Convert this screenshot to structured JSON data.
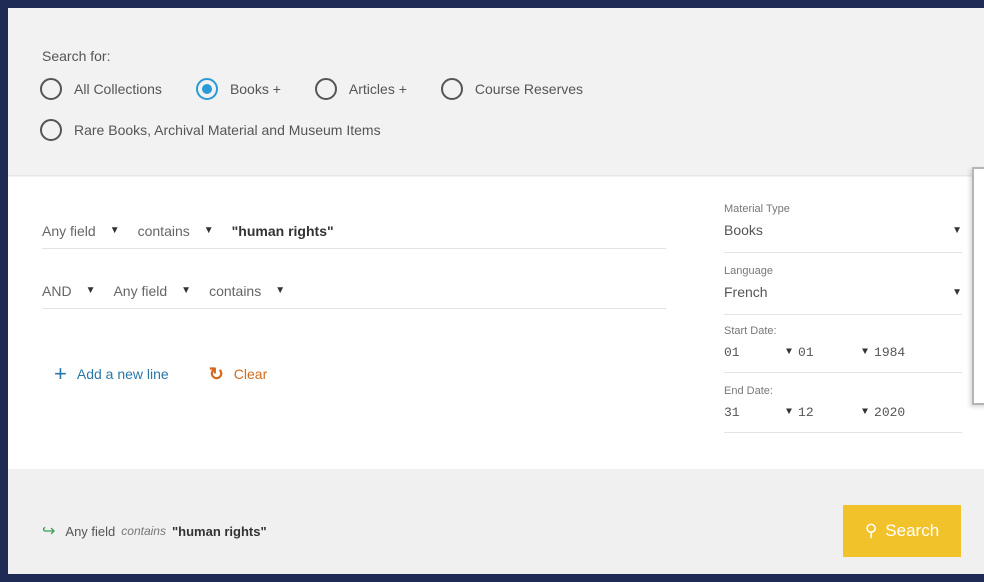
{
  "search_for": {
    "label": "Search for:",
    "options": [
      {
        "label": "All Collections",
        "selected": false
      },
      {
        "label": "Books +",
        "selected": true
      },
      {
        "label": "Articles +",
        "selected": false
      },
      {
        "label": "Course Reserves",
        "selected": false
      },
      {
        "label": "Rare Books, Archival Material and Museum Items",
        "selected": false
      }
    ]
  },
  "query_lines": [
    {
      "field": "Any field",
      "operator": "contains",
      "value": "\"human rights\""
    },
    {
      "boolean": "AND",
      "field": "Any field",
      "operator": "contains",
      "value": ""
    }
  ],
  "actions": {
    "add_line": "Add a new line",
    "clear": "Clear"
  },
  "facets": {
    "material_type": {
      "label": "Material Type",
      "value": "Books"
    },
    "language": {
      "label": "Language",
      "value": "French"
    },
    "start_date": {
      "label": "Start Date:",
      "day": "01",
      "month": "01",
      "year": "1984"
    },
    "end_date": {
      "label": "End Date:",
      "day": "31",
      "month": "12",
      "year": "2020"
    }
  },
  "summary": {
    "field": "Any field",
    "operator": "contains",
    "value": "\"human rights\""
  },
  "search_button": {
    "label": "Search"
  },
  "icons": {
    "radio": "radio-icon",
    "caret": "caret-down-icon",
    "add": "plus-icon",
    "clear": "undo-icon",
    "summary_arrow": "arrow-right-icon",
    "search": "magnifier-icon"
  },
  "colors": {
    "accent_blue": "#2a9bd6",
    "clear_orange": "#d26a1c",
    "search_yellow": "#f2c22a",
    "arrow_green": "#3aa05a",
    "frame_navy": "#1f2a55"
  }
}
